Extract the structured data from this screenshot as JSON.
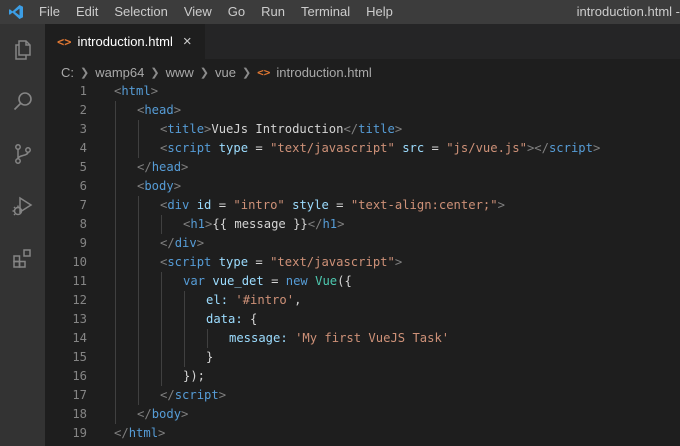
{
  "window": {
    "title": "introduction.html -",
    "menu": [
      "File",
      "Edit",
      "Selection",
      "View",
      "Go",
      "Run",
      "Terminal",
      "Help"
    ]
  },
  "activity_icons": [
    "explorer-icon",
    "search-icon",
    "source-control-icon",
    "run-debug-icon",
    "extensions-icon"
  ],
  "tab": {
    "icon": "<>",
    "label": "introduction.html",
    "close": "×"
  },
  "breadcrumb": [
    "C:",
    "wamp64",
    "www",
    "vue",
    "introduction.html"
  ],
  "editor": {
    "lines": [
      {
        "n": "1",
        "indent": 0,
        "tokens": [
          [
            "p",
            "<"
          ],
          [
            "t",
            "html"
          ],
          [
            "p",
            ">"
          ]
        ]
      },
      {
        "n": "2",
        "indent": 1,
        "tokens": [
          [
            "p",
            "<"
          ],
          [
            "t",
            "head"
          ],
          [
            "p",
            ">"
          ]
        ]
      },
      {
        "n": "3",
        "indent": 2,
        "tokens": [
          [
            "p",
            "<"
          ],
          [
            "t",
            "title"
          ],
          [
            "p",
            ">"
          ],
          [
            "w",
            "VueJs Introduction"
          ],
          [
            "p",
            "</"
          ],
          [
            "t",
            "title"
          ],
          [
            "p",
            ">"
          ]
        ]
      },
      {
        "n": "4",
        "indent": 2,
        "tokens": [
          [
            "p",
            "<"
          ],
          [
            "t",
            "script"
          ],
          [
            "w",
            " "
          ],
          [
            "a",
            "type"
          ],
          [
            "w",
            " = "
          ],
          [
            "s",
            "\"text/javascript\""
          ],
          [
            "w",
            " "
          ],
          [
            "a",
            "src"
          ],
          [
            "w",
            " = "
          ],
          [
            "s",
            "\"js/vue.js\""
          ],
          [
            "p",
            "></"
          ],
          [
            "t",
            "script"
          ],
          [
            "p",
            ">"
          ]
        ]
      },
      {
        "n": "5",
        "indent": 1,
        "tokens": [
          [
            "p",
            "</"
          ],
          [
            "t",
            "head"
          ],
          [
            "p",
            ">"
          ]
        ]
      },
      {
        "n": "6",
        "indent": 1,
        "tokens": [
          [
            "p",
            "<"
          ],
          [
            "t",
            "body"
          ],
          [
            "p",
            ">"
          ]
        ]
      },
      {
        "n": "7",
        "indent": 2,
        "tokens": [
          [
            "p",
            "<"
          ],
          [
            "t",
            "div"
          ],
          [
            "w",
            " "
          ],
          [
            "a",
            "id"
          ],
          [
            "w",
            " = "
          ],
          [
            "s",
            "\"intro\""
          ],
          [
            "w",
            " "
          ],
          [
            "a",
            "style"
          ],
          [
            "w",
            " = "
          ],
          [
            "s",
            "\"text-align:center;\""
          ],
          [
            "p",
            ">"
          ]
        ]
      },
      {
        "n": "8",
        "indent": 3,
        "tokens": [
          [
            "p",
            "<"
          ],
          [
            "t",
            "h1"
          ],
          [
            "p",
            ">"
          ],
          [
            "w",
            "{{ message }}"
          ],
          [
            "p",
            "</"
          ],
          [
            "t",
            "h1"
          ],
          [
            "p",
            ">"
          ]
        ]
      },
      {
        "n": "9",
        "indent": 2,
        "tokens": [
          [
            "p",
            "</"
          ],
          [
            "t",
            "div"
          ],
          [
            "p",
            ">"
          ]
        ]
      },
      {
        "n": "10",
        "indent": 2,
        "tokens": [
          [
            "p",
            "<"
          ],
          [
            "t",
            "script"
          ],
          [
            "w",
            " "
          ],
          [
            "a",
            "type"
          ],
          [
            "w",
            " = "
          ],
          [
            "s",
            "\"text/javascript\""
          ],
          [
            "p",
            ">"
          ]
        ]
      },
      {
        "n": "11",
        "indent": 3,
        "tokens": [
          [
            "k",
            "var"
          ],
          [
            "w",
            " "
          ],
          [
            "a",
            "vue_det"
          ],
          [
            "w",
            " = "
          ],
          [
            "k",
            "new"
          ],
          [
            "w",
            " "
          ],
          [
            "c",
            "Vue"
          ],
          [
            "w",
            "({"
          ]
        ]
      },
      {
        "n": "12",
        "indent": 4,
        "tokens": [
          [
            "a",
            "el"
          ],
          [
            "a",
            ":"
          ],
          [
            "w",
            " "
          ],
          [
            "s",
            "'#intro'"
          ],
          [
            "w",
            ","
          ]
        ]
      },
      {
        "n": "13",
        "indent": 4,
        "tokens": [
          [
            "a",
            "data"
          ],
          [
            "a",
            ":"
          ],
          [
            "w",
            " {"
          ]
        ]
      },
      {
        "n": "14",
        "indent": 5,
        "tokens": [
          [
            "a",
            "message"
          ],
          [
            "a",
            ":"
          ],
          [
            "w",
            " "
          ],
          [
            "s",
            "'My first VueJS Task'"
          ]
        ]
      },
      {
        "n": "15",
        "indent": 4,
        "tokens": [
          [
            "w",
            "}"
          ]
        ]
      },
      {
        "n": "16",
        "indent": 3,
        "tokens": [
          [
            "w",
            "});"
          ]
        ]
      },
      {
        "n": "17",
        "indent": 2,
        "tokens": [
          [
            "p",
            "</"
          ],
          [
            "t",
            "script"
          ],
          [
            "p",
            ">"
          ]
        ]
      },
      {
        "n": "18",
        "indent": 1,
        "tokens": [
          [
            "p",
            "</"
          ],
          [
            "t",
            "body"
          ],
          [
            "p",
            ">"
          ]
        ]
      },
      {
        "n": "19",
        "indent": 0,
        "tokens": [
          [
            "p",
            "</"
          ],
          [
            "t",
            "html"
          ],
          [
            "p",
            ">"
          ]
        ]
      }
    ]
  }
}
